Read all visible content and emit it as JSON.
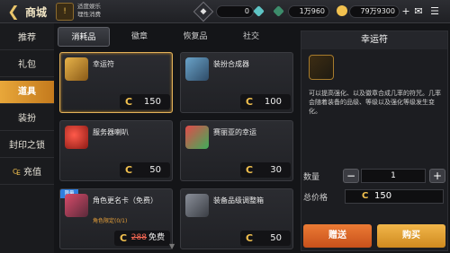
{
  "header": {
    "title": "商城",
    "notice_line1": "适度娱乐",
    "notice_line2": "理性消费",
    "currencies": [
      {
        "icon": "diamond-icon",
        "value": "0"
      },
      {
        "icon": "bound-diamond-icon",
        "value": "1万960"
      },
      {
        "icon": "gold-icon",
        "value": "79万9300"
      }
    ]
  },
  "sidebar": {
    "items": [
      {
        "label": "推荐"
      },
      {
        "label": "礼包"
      },
      {
        "label": "道具"
      },
      {
        "label": "装扮"
      },
      {
        "label": "封印之锁"
      },
      {
        "label": "充值"
      }
    ],
    "active_index": 2
  },
  "tabs": [
    {
      "label": "消耗品"
    },
    {
      "label": "徽章"
    },
    {
      "label": "恢复品"
    },
    {
      "label": "社交"
    }
  ],
  "items": [
    {
      "name": "幸运符",
      "price": "150"
    },
    {
      "name": "装扮合成器",
      "price": "100"
    },
    {
      "name": "服务器喇叭",
      "price": "50"
    },
    {
      "name": "赛丽亚的幸运",
      "price": "30"
    },
    {
      "name": "角色更名卡（免费）",
      "sub": "角色限定(0/1)",
      "old_price": "288",
      "price": "免费",
      "ribbon": "限量"
    },
    {
      "name": "装备品级调整箱",
      "price": "50"
    }
  ],
  "currency_symbol": "C",
  "detail": {
    "title": "幸运符",
    "description": "可以提高强化、以及徽章合成几率的符咒。几率会随着装备的品级、等级以及强化等级发生变化。",
    "qty_label": "数量",
    "qty_minus": "−",
    "qty_value": "1",
    "qty_plus": "+",
    "total_label": "总价格",
    "total_value": "150",
    "gift_label": "赠送",
    "buy_label": "购买"
  },
  "colors": {
    "accent": "#e3a33a",
    "gift_button": "#d9622a",
    "buy_button": "#e3a33a"
  }
}
